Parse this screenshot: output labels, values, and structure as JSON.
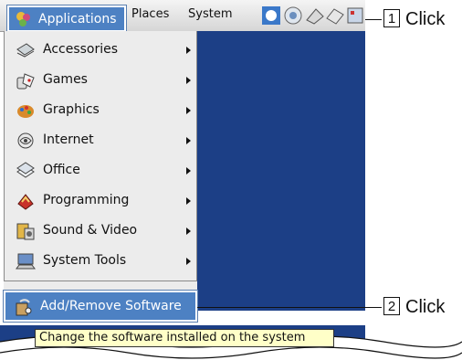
{
  "panel": {
    "applications_label": "Applications",
    "places_label": "Places",
    "system_label": "System"
  },
  "menu": {
    "items": [
      {
        "label": "Accessories",
        "icon": "accessories-icon"
      },
      {
        "label": "Games",
        "icon": "games-icon"
      },
      {
        "label": "Graphics",
        "icon": "graphics-icon"
      },
      {
        "label": "Internet",
        "icon": "internet-icon"
      },
      {
        "label": "Office",
        "icon": "office-icon"
      },
      {
        "label": "Programming",
        "icon": "programming-icon"
      },
      {
        "label": "Sound & Video",
        "icon": "sound-video-icon"
      },
      {
        "label": "System Tools",
        "icon": "system-tools-icon"
      }
    ],
    "add_remove_label": "Add/Remove Software"
  },
  "tooltip": "Change the software installed on the system",
  "callouts": [
    {
      "number": "1",
      "text": "Click"
    },
    {
      "number": "2",
      "text": "Click"
    }
  ],
  "colors": {
    "highlight": "#4d81c3",
    "desktop": "#1c3f86",
    "menu_bg": "#ececec",
    "tooltip_bg": "#ffffc8"
  }
}
